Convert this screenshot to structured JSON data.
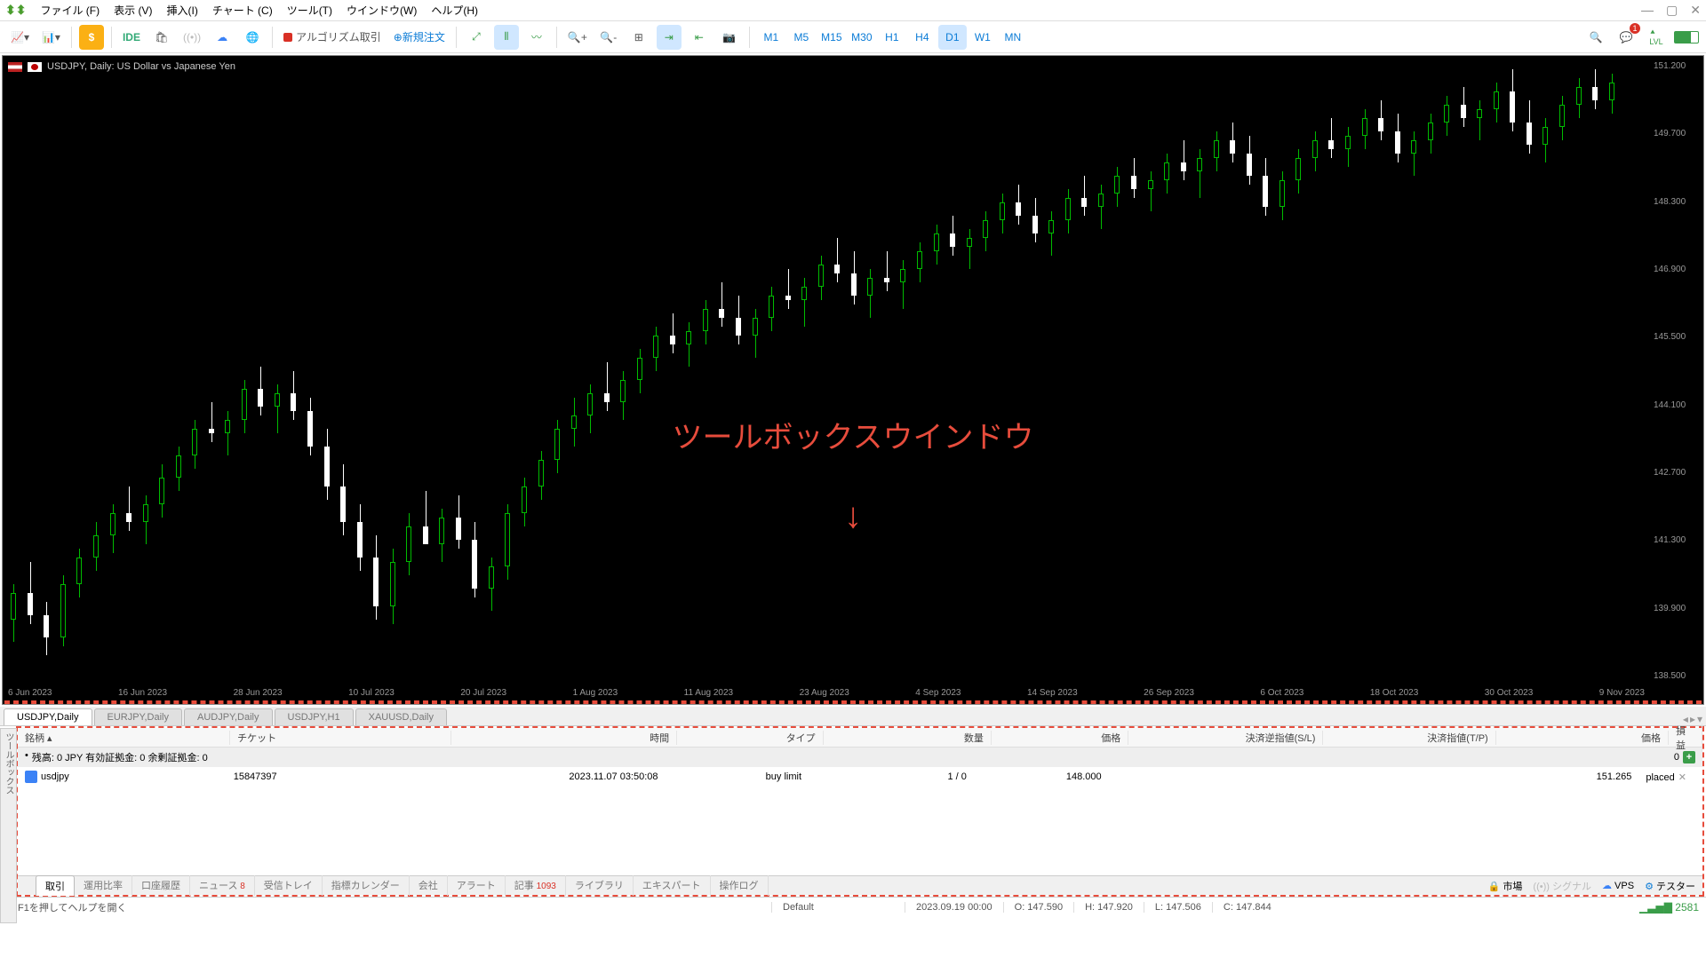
{
  "menu": [
    "ファイル (F)",
    "表示 (V)",
    "挿入(I)",
    "チャート (C)",
    "ツール(T)",
    "ウインドウ(W)",
    "ヘルプ(H)"
  ],
  "toolbar": {
    "ide": "IDE",
    "algo": "アルゴリズム取引",
    "new_order": "新規注文",
    "timeframes": [
      "M1",
      "M5",
      "M15",
      "M30",
      "H1",
      "H4",
      "D1",
      "W1",
      "MN"
    ],
    "tf_active": "D1"
  },
  "chart": {
    "title": "USDJPY, Daily:  US Dollar vs Japanese Yen",
    "annotation": "ツールボックスウインドウ",
    "price_ticks": [
      "151.200",
      "149.700",
      "148.300",
      "146.900",
      "145.500",
      "144.100",
      "142.700",
      "141.300",
      "139.900",
      "138.500"
    ],
    "date_ticks": [
      "6 Jun 2023",
      "16 Jun 2023",
      "28 Jun 2023",
      "10 Jul 2023",
      "20 Jul 2023",
      "1 Aug 2023",
      "11 Aug 2023",
      "23 Aug 2023",
      "4 Sep 2023",
      "14 Sep 2023",
      "26 Sep 2023",
      "6 Oct 2023",
      "18 Oct 2023",
      "30 Oct 2023",
      "9 Nov 2023"
    ]
  },
  "symbol_tabs": [
    "USDJPY,Daily",
    "EURJPY,Daily",
    "AUDJPY,Daily",
    "USDJPY,H1",
    "XAUUSD,Daily"
  ],
  "symbol_tab_active": "USDJPY,Daily",
  "toolbox": {
    "vertical_label": "ツールボックス",
    "columns": {
      "symbol": "銘柄",
      "ticket": "チケット",
      "time": "時間",
      "type": "タイプ",
      "volume": "数量",
      "price": "価格",
      "sl": "決済逆指値(S/L)",
      "tp": "決済指値(T/P)",
      "price2": "価格",
      "profit": "損益"
    },
    "balance": "残高: 0 JPY  有効証拠金: 0  余剰証拠金: 0",
    "balance_end": "0",
    "order": {
      "symbol": "usdjpy",
      "ticket": "15847397",
      "time": "2023.11.07 03:50:08",
      "type": "buy limit",
      "volume": "1 / 0",
      "price": "148.000",
      "sl": "",
      "tp": "",
      "price2": "151.265",
      "profit": "placed"
    },
    "tabs": [
      "取引",
      "運用比率",
      "口座履歴",
      "ニュース",
      "受信トレイ",
      "指標カレンダー",
      "会社",
      "アラート",
      "記事",
      "ライブラリ",
      "エキスパート",
      "操作ログ"
    ],
    "tab_active": "取引",
    "news_badge": "8",
    "article_badge": "1093",
    "right": {
      "market": "市場",
      "signal": "シグナル",
      "vps": "VPS",
      "tester": "テスター"
    }
  },
  "status": {
    "help": "F1を押してヘルプを開く",
    "profile": "Default",
    "datetime": "2023.09.19 00:00",
    "o": "O: 147.590",
    "h": "H: 147.920",
    "l": "L: 147.506",
    "c": "C: 147.844",
    "conn": "2581"
  },
  "chart_data": {
    "type": "candlestick",
    "symbol": "USDJPY",
    "timeframe": "Daily",
    "ylim": [
      138.0,
      152.0
    ],
    "candles": [
      {
        "x": 0.005,
        "o": 139.3,
        "h": 140.1,
        "l": 138.8,
        "c": 139.9
      },
      {
        "x": 0.015,
        "o": 139.9,
        "h": 140.6,
        "l": 139.2,
        "c": 139.4
      },
      {
        "x": 0.025,
        "o": 139.4,
        "h": 139.7,
        "l": 138.5,
        "c": 138.9
      },
      {
        "x": 0.035,
        "o": 138.9,
        "h": 140.3,
        "l": 138.7,
        "c": 140.1
      },
      {
        "x": 0.045,
        "o": 140.1,
        "h": 140.9,
        "l": 139.8,
        "c": 140.7
      },
      {
        "x": 0.055,
        "o": 140.7,
        "h": 141.5,
        "l": 140.4,
        "c": 141.2
      },
      {
        "x": 0.065,
        "o": 141.2,
        "h": 141.9,
        "l": 140.8,
        "c": 141.7
      },
      {
        "x": 0.075,
        "o": 141.7,
        "h": 142.3,
        "l": 141.3,
        "c": 141.5
      },
      {
        "x": 0.085,
        "o": 141.5,
        "h": 142.1,
        "l": 141.0,
        "c": 141.9
      },
      {
        "x": 0.095,
        "o": 141.9,
        "h": 142.8,
        "l": 141.6,
        "c": 142.5
      },
      {
        "x": 0.105,
        "o": 142.5,
        "h": 143.2,
        "l": 142.2,
        "c": 143.0
      },
      {
        "x": 0.115,
        "o": 143.0,
        "h": 143.8,
        "l": 142.7,
        "c": 143.6
      },
      {
        "x": 0.125,
        "o": 143.6,
        "h": 144.2,
        "l": 143.3,
        "c": 143.5
      },
      {
        "x": 0.135,
        "o": 143.5,
        "h": 144.0,
        "l": 143.0,
        "c": 143.8
      },
      {
        "x": 0.145,
        "o": 143.8,
        "h": 144.7,
        "l": 143.5,
        "c": 144.5
      },
      {
        "x": 0.155,
        "o": 144.5,
        "h": 145.0,
        "l": 143.9,
        "c": 144.1
      },
      {
        "x": 0.165,
        "o": 144.1,
        "h": 144.6,
        "l": 143.5,
        "c": 144.4
      },
      {
        "x": 0.175,
        "o": 144.4,
        "h": 144.9,
        "l": 143.8,
        "c": 144.0
      },
      {
        "x": 0.185,
        "o": 144.0,
        "h": 144.3,
        "l": 143.0,
        "c": 143.2
      },
      {
        "x": 0.195,
        "o": 143.2,
        "h": 143.6,
        "l": 142.0,
        "c": 142.3
      },
      {
        "x": 0.205,
        "o": 142.3,
        "h": 142.8,
        "l": 141.2,
        "c": 141.5
      },
      {
        "x": 0.215,
        "o": 141.5,
        "h": 141.9,
        "l": 140.4,
        "c": 140.7
      },
      {
        "x": 0.225,
        "o": 140.7,
        "h": 141.2,
        "l": 139.3,
        "c": 139.6
      },
      {
        "x": 0.235,
        "o": 139.6,
        "h": 140.9,
        "l": 139.2,
        "c": 140.6
      },
      {
        "x": 0.245,
        "o": 140.6,
        "h": 141.7,
        "l": 140.3,
        "c": 141.4
      },
      {
        "x": 0.255,
        "o": 141.4,
        "h": 142.2,
        "l": 141.0,
        "c": 141.0
      },
      {
        "x": 0.265,
        "o": 141.0,
        "h": 141.8,
        "l": 140.6,
        "c": 141.6
      },
      {
        "x": 0.275,
        "o": 141.6,
        "h": 142.1,
        "l": 140.9,
        "c": 141.1
      },
      {
        "x": 0.285,
        "o": 141.1,
        "h": 141.5,
        "l": 139.8,
        "c": 140.0
      },
      {
        "x": 0.295,
        "o": 140.0,
        "h": 140.7,
        "l": 139.5,
        "c": 140.5
      },
      {
        "x": 0.305,
        "o": 140.5,
        "h": 141.9,
        "l": 140.2,
        "c": 141.7
      },
      {
        "x": 0.315,
        "o": 141.7,
        "h": 142.5,
        "l": 141.4,
        "c": 142.3
      },
      {
        "x": 0.325,
        "o": 142.3,
        "h": 143.1,
        "l": 142.0,
        "c": 142.9
      },
      {
        "x": 0.335,
        "o": 142.9,
        "h": 143.8,
        "l": 142.6,
        "c": 143.6
      },
      {
        "x": 0.345,
        "o": 143.6,
        "h": 144.3,
        "l": 143.2,
        "c": 143.9
      },
      {
        "x": 0.355,
        "o": 143.9,
        "h": 144.6,
        "l": 143.5,
        "c": 144.4
      },
      {
        "x": 0.365,
        "o": 144.4,
        "h": 145.1,
        "l": 144.0,
        "c": 144.2
      },
      {
        "x": 0.375,
        "o": 144.2,
        "h": 144.9,
        "l": 143.8,
        "c": 144.7
      },
      {
        "x": 0.385,
        "o": 144.7,
        "h": 145.4,
        "l": 144.4,
        "c": 145.2
      },
      {
        "x": 0.395,
        "o": 145.2,
        "h": 145.9,
        "l": 144.9,
        "c": 145.7
      },
      {
        "x": 0.405,
        "o": 145.7,
        "h": 146.2,
        "l": 145.3,
        "c": 145.5
      },
      {
        "x": 0.415,
        "o": 145.5,
        "h": 146.0,
        "l": 145.0,
        "c": 145.8
      },
      {
        "x": 0.425,
        "o": 145.8,
        "h": 146.5,
        "l": 145.5,
        "c": 146.3
      },
      {
        "x": 0.435,
        "o": 146.3,
        "h": 146.9,
        "l": 145.9,
        "c": 146.1
      },
      {
        "x": 0.445,
        "o": 146.1,
        "h": 146.6,
        "l": 145.5,
        "c": 145.7
      },
      {
        "x": 0.455,
        "o": 145.7,
        "h": 146.3,
        "l": 145.2,
        "c": 146.1
      },
      {
        "x": 0.465,
        "o": 146.1,
        "h": 146.8,
        "l": 145.8,
        "c": 146.6
      },
      {
        "x": 0.475,
        "o": 146.6,
        "h": 147.2,
        "l": 146.3,
        "c": 146.5
      },
      {
        "x": 0.485,
        "o": 146.5,
        "h": 147.0,
        "l": 145.9,
        "c": 146.8
      },
      {
        "x": 0.495,
        "o": 146.8,
        "h": 147.5,
        "l": 146.5,
        "c": 147.3
      },
      {
        "x": 0.505,
        "o": 147.3,
        "h": 147.9,
        "l": 146.9,
        "c": 147.1
      },
      {
        "x": 0.515,
        "o": 147.1,
        "h": 147.6,
        "l": 146.4,
        "c": 146.6
      },
      {
        "x": 0.525,
        "o": 146.6,
        "h": 147.2,
        "l": 146.1,
        "c": 147.0
      },
      {
        "x": 0.535,
        "o": 147.0,
        "h": 147.6,
        "l": 146.7,
        "c": 146.9
      },
      {
        "x": 0.545,
        "o": 146.9,
        "h": 147.4,
        "l": 146.3,
        "c": 147.2
      },
      {
        "x": 0.555,
        "o": 147.2,
        "h": 147.8,
        "l": 146.9,
        "c": 147.6
      },
      {
        "x": 0.565,
        "o": 147.6,
        "h": 148.2,
        "l": 147.3,
        "c": 148.0
      },
      {
        "x": 0.575,
        "o": 148.0,
        "h": 148.4,
        "l": 147.5,
        "c": 147.7
      },
      {
        "x": 0.585,
        "o": 147.7,
        "h": 148.1,
        "l": 147.2,
        "c": 147.9
      },
      {
        "x": 0.595,
        "o": 147.9,
        "h": 148.5,
        "l": 147.6,
        "c": 148.3
      },
      {
        "x": 0.605,
        "o": 148.3,
        "h": 148.9,
        "l": 148.0,
        "c": 148.7
      },
      {
        "x": 0.615,
        "o": 148.7,
        "h": 149.1,
        "l": 148.2,
        "c": 148.4
      },
      {
        "x": 0.625,
        "o": 148.4,
        "h": 148.8,
        "l": 147.8,
        "c": 148.0
      },
      {
        "x": 0.635,
        "o": 148.0,
        "h": 148.5,
        "l": 147.5,
        "c": 148.3
      },
      {
        "x": 0.645,
        "o": 148.3,
        "h": 149.0,
        "l": 148.0,
        "c": 148.8
      },
      {
        "x": 0.655,
        "o": 148.8,
        "h": 149.3,
        "l": 148.4,
        "c": 148.6
      },
      {
        "x": 0.665,
        "o": 148.6,
        "h": 149.1,
        "l": 148.1,
        "c": 148.9
      },
      {
        "x": 0.675,
        "o": 148.9,
        "h": 149.5,
        "l": 148.6,
        "c": 149.3
      },
      {
        "x": 0.685,
        "o": 149.3,
        "h": 149.7,
        "l": 148.8,
        "c": 149.0
      },
      {
        "x": 0.695,
        "o": 149.0,
        "h": 149.4,
        "l": 148.5,
        "c": 149.2
      },
      {
        "x": 0.705,
        "o": 149.2,
        "h": 149.8,
        "l": 148.9,
        "c": 149.6
      },
      {
        "x": 0.715,
        "o": 149.6,
        "h": 150.1,
        "l": 149.2,
        "c": 149.4
      },
      {
        "x": 0.725,
        "o": 149.4,
        "h": 149.9,
        "l": 148.8,
        "c": 149.7
      },
      {
        "x": 0.735,
        "o": 149.7,
        "h": 150.3,
        "l": 149.4,
        "c": 150.1
      },
      {
        "x": 0.745,
        "o": 150.1,
        "h": 150.5,
        "l": 149.6,
        "c": 149.8
      },
      {
        "x": 0.755,
        "o": 149.8,
        "h": 150.2,
        "l": 149.1,
        "c": 149.3
      },
      {
        "x": 0.765,
        "o": 149.3,
        "h": 149.7,
        "l": 148.4,
        "c": 148.6
      },
      {
        "x": 0.775,
        "o": 148.6,
        "h": 149.4,
        "l": 148.3,
        "c": 149.2
      },
      {
        "x": 0.785,
        "o": 149.2,
        "h": 149.9,
        "l": 148.9,
        "c": 149.7
      },
      {
        "x": 0.795,
        "o": 149.7,
        "h": 150.3,
        "l": 149.4,
        "c": 150.1
      },
      {
        "x": 0.805,
        "o": 150.1,
        "h": 150.6,
        "l": 149.7,
        "c": 149.9
      },
      {
        "x": 0.815,
        "o": 149.9,
        "h": 150.4,
        "l": 149.5,
        "c": 150.2
      },
      {
        "x": 0.825,
        "o": 150.2,
        "h": 150.8,
        "l": 149.9,
        "c": 150.6
      },
      {
        "x": 0.835,
        "o": 150.6,
        "h": 151.0,
        "l": 150.1,
        "c": 150.3
      },
      {
        "x": 0.845,
        "o": 150.3,
        "h": 150.7,
        "l": 149.6,
        "c": 149.8
      },
      {
        "x": 0.855,
        "o": 149.8,
        "h": 150.3,
        "l": 149.3,
        "c": 150.1
      },
      {
        "x": 0.865,
        "o": 150.1,
        "h": 150.7,
        "l": 149.8,
        "c": 150.5
      },
      {
        "x": 0.875,
        "o": 150.5,
        "h": 151.1,
        "l": 150.2,
        "c": 150.9
      },
      {
        "x": 0.885,
        "o": 150.9,
        "h": 151.3,
        "l": 150.4,
        "c": 150.6
      },
      {
        "x": 0.895,
        "o": 150.6,
        "h": 151.0,
        "l": 150.1,
        "c": 150.8
      },
      {
        "x": 0.905,
        "o": 150.8,
        "h": 151.4,
        "l": 150.5,
        "c": 151.2
      },
      {
        "x": 0.915,
        "o": 151.2,
        "h": 151.7,
        "l": 150.3,
        "c": 150.5
      },
      {
        "x": 0.925,
        "o": 150.5,
        "h": 151.0,
        "l": 149.8,
        "c": 150.0
      },
      {
        "x": 0.935,
        "o": 150.0,
        "h": 150.6,
        "l": 149.6,
        "c": 150.4
      },
      {
        "x": 0.945,
        "o": 150.4,
        "h": 151.1,
        "l": 150.1,
        "c": 150.9
      },
      {
        "x": 0.955,
        "o": 150.9,
        "h": 151.5,
        "l": 150.6,
        "c": 151.3
      },
      {
        "x": 0.965,
        "o": 151.3,
        "h": 151.7,
        "l": 150.8,
        "c": 151.0
      },
      {
        "x": 0.975,
        "o": 151.0,
        "h": 151.6,
        "l": 150.7,
        "c": 151.4
      }
    ]
  }
}
